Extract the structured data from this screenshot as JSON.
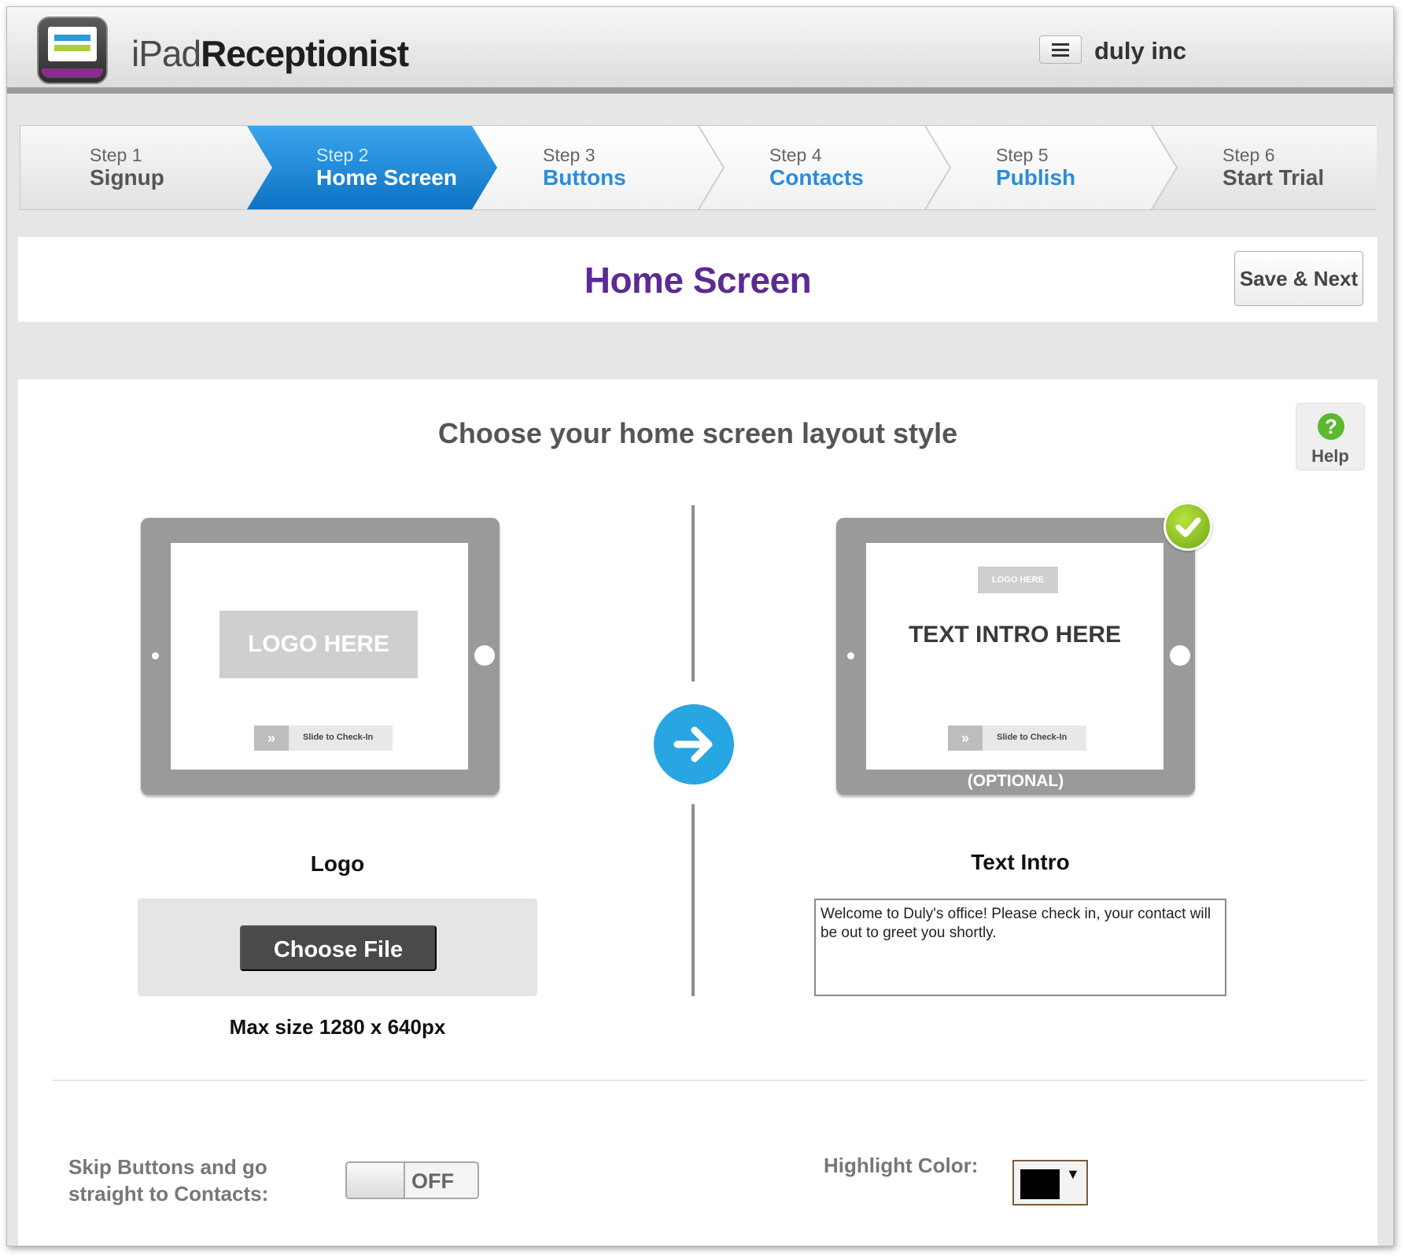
{
  "header": {
    "app_title_light": "iPad",
    "app_title_bold": "Receptionist",
    "menu_icon": "hamburger-menu-icon",
    "company_name": "duly inc"
  },
  "stepper": {
    "steps": [
      {
        "num": "Step 1",
        "name": "Signup"
      },
      {
        "num": "Step 2",
        "name": "Home Screen"
      },
      {
        "num": "Step 3",
        "name": "Buttons"
      },
      {
        "num": "Step 4",
        "name": "Contacts"
      },
      {
        "num": "Step 5",
        "name": "Publish"
      },
      {
        "num": "Step 6",
        "name": "Start Trial"
      }
    ],
    "active_index": 1,
    "colors": {
      "active": "#1a8bdc",
      "link": "#2a8ddb"
    }
  },
  "page": {
    "title": "Home Screen",
    "title_color": "#5b2b93",
    "save_next": "Save & Next"
  },
  "layout_section": {
    "heading": "Choose your home screen layout style",
    "help_label": "Help",
    "help_icon": "question-mark-icon"
  },
  "logo_preview": {
    "logo_placeholder": "LOGO HERE",
    "slide_text": "Slide to Check-In",
    "slide_icon": "double-chevron-icon"
  },
  "intro_preview": {
    "logo_placeholder": "LOGO HERE",
    "intro_placeholder": "TEXT INTRO HERE",
    "slide_text": "Slide to Check-In",
    "optional_label": "(OPTIONAL)",
    "selected_icon": "checkmark-icon"
  },
  "logo_option": {
    "label": "Logo",
    "choose_file": "Choose File",
    "max_size": "Max size 1280 x 640px"
  },
  "intro_option": {
    "label": "Text Intro",
    "text_value": "Welcome to Duly's office! Please check in, your contact will be out to greet you shortly."
  },
  "settings": {
    "skip_label_line1": "Skip Buttons and go",
    "skip_label_line2": "straight to Contacts:",
    "toggle_state": "OFF",
    "highlight_label": "Highlight Color:",
    "highlight_color": "#000000",
    "dropdown_arrow": "▼"
  }
}
